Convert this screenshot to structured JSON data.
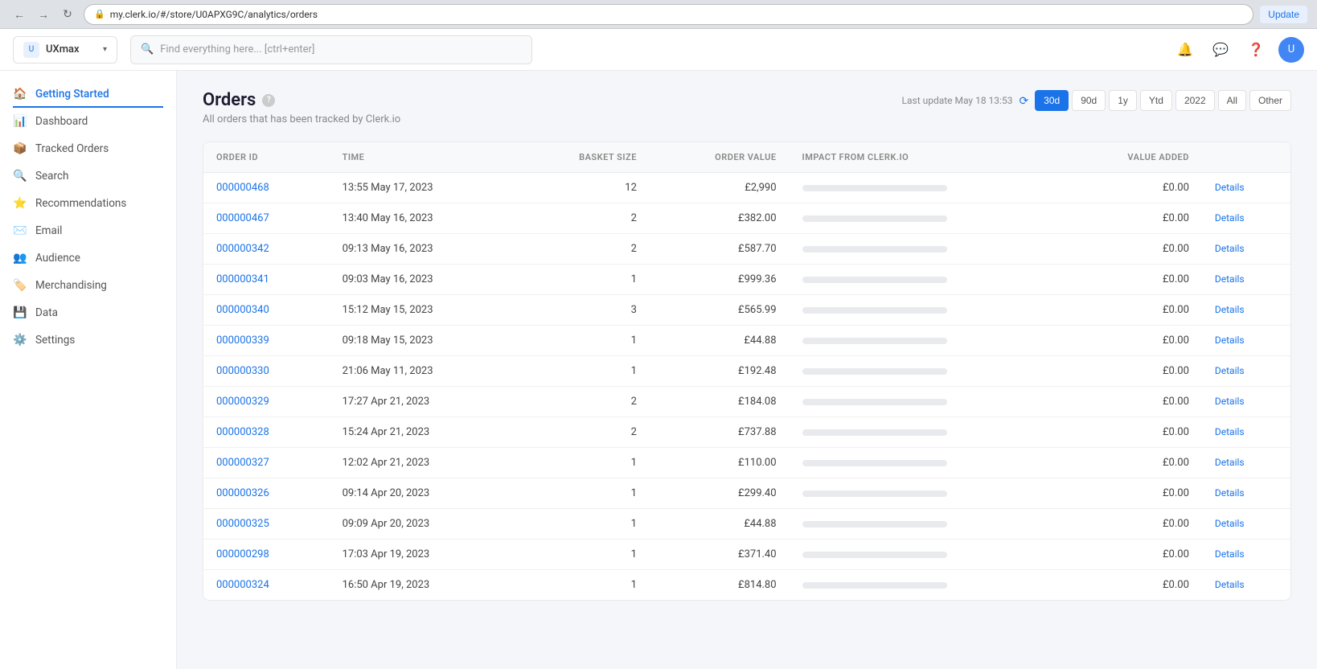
{
  "browser": {
    "url": "my.clerk.io/#/store/U0APXG9C/analytics/orders",
    "update_label": "Update"
  },
  "app": {
    "store_name": "UXmax",
    "search_placeholder": "Find everything here... [ctrl+enter]"
  },
  "sidebar": {
    "items": [
      {
        "id": "getting-started",
        "label": "Getting Started",
        "active": true,
        "icon": "🏠"
      },
      {
        "id": "dashboard",
        "label": "Dashboard",
        "active": false,
        "icon": "📊"
      },
      {
        "id": "tracked-orders",
        "label": "Tracked Orders",
        "active": false,
        "icon": "📦"
      },
      {
        "id": "search",
        "label": "Search",
        "active": false,
        "icon": "🔍"
      },
      {
        "id": "recommendations",
        "label": "Recommendations",
        "active": false,
        "icon": "⭐"
      },
      {
        "id": "email",
        "label": "Email",
        "active": false,
        "icon": "✉️"
      },
      {
        "id": "audience",
        "label": "Audience",
        "active": false,
        "icon": "👥"
      },
      {
        "id": "merchandising",
        "label": "Merchandising",
        "active": false,
        "icon": "🏷️"
      },
      {
        "id": "data",
        "label": "Data",
        "active": false,
        "icon": "💾"
      },
      {
        "id": "settings",
        "label": "Settings",
        "active": false,
        "icon": "⚙️"
      }
    ]
  },
  "page": {
    "title": "Orders",
    "subtitle": "All orders that has been tracked by Clerk.io",
    "last_update_label": "Last update May 18 13:53"
  },
  "time_filters": [
    {
      "label": "30d",
      "active": true
    },
    {
      "label": "90d",
      "active": false
    },
    {
      "label": "1y",
      "active": false
    },
    {
      "label": "Ytd",
      "active": false
    },
    {
      "label": "2022",
      "active": false
    },
    {
      "label": "All",
      "active": false
    },
    {
      "label": "Other",
      "active": false
    }
  ],
  "table": {
    "columns": [
      {
        "key": "order_id",
        "label": "ORDER ID"
      },
      {
        "key": "time",
        "label": "TIME"
      },
      {
        "key": "basket_size",
        "label": "BASKET SIZE"
      },
      {
        "key": "order_value",
        "label": "ORDER VALUE"
      },
      {
        "key": "impact",
        "label": "IMPACT FROM CLERK.IO"
      },
      {
        "key": "value_added",
        "label": "VALUE ADDED"
      },
      {
        "key": "action",
        "label": ""
      }
    ],
    "rows": [
      {
        "order_id": "000000468",
        "time": "13:55 May 17, 2023",
        "basket_size": "12",
        "order_value": "£2,990",
        "impact_pct": 0,
        "value_added": "£0.00"
      },
      {
        "order_id": "000000467",
        "time": "13:40 May 16, 2023",
        "basket_size": "2",
        "order_value": "£382.00",
        "impact_pct": 0,
        "value_added": "£0.00"
      },
      {
        "order_id": "000000342",
        "time": "09:13 May 16, 2023",
        "basket_size": "2",
        "order_value": "£587.70",
        "impact_pct": 0,
        "value_added": "£0.00"
      },
      {
        "order_id": "000000341",
        "time": "09:03 May 16, 2023",
        "basket_size": "1",
        "order_value": "£999.36",
        "impact_pct": 0,
        "value_added": "£0.00"
      },
      {
        "order_id": "000000340",
        "time": "15:12 May 15, 2023",
        "basket_size": "3",
        "order_value": "£565.99",
        "impact_pct": 0,
        "value_added": "£0.00"
      },
      {
        "order_id": "000000339",
        "time": "09:18 May 15, 2023",
        "basket_size": "1",
        "order_value": "£44.88",
        "impact_pct": 0,
        "value_added": "£0.00"
      },
      {
        "order_id": "000000330",
        "time": "21:06 May 11, 2023",
        "basket_size": "1",
        "order_value": "£192.48",
        "impact_pct": 0,
        "value_added": "£0.00"
      },
      {
        "order_id": "000000329",
        "time": "17:27 Apr 21, 2023",
        "basket_size": "2",
        "order_value": "£184.08",
        "impact_pct": 0,
        "value_added": "£0.00"
      },
      {
        "order_id": "000000328",
        "time": "15:24 Apr 21, 2023",
        "basket_size": "2",
        "order_value": "£737.88",
        "impact_pct": 0,
        "value_added": "£0.00"
      },
      {
        "order_id": "000000327",
        "time": "12:02 Apr 21, 2023",
        "basket_size": "1",
        "order_value": "£110.00",
        "impact_pct": 0,
        "value_added": "£0.00"
      },
      {
        "order_id": "000000326",
        "time": "09:14 Apr 20, 2023",
        "basket_size": "1",
        "order_value": "£299.40",
        "impact_pct": 0,
        "value_added": "£0.00"
      },
      {
        "order_id": "000000325",
        "time": "09:09 Apr 20, 2023",
        "basket_size": "1",
        "order_value": "£44.88",
        "impact_pct": 0,
        "value_added": "£0.00"
      },
      {
        "order_id": "000000298",
        "time": "17:03 Apr 19, 2023",
        "basket_size": "1",
        "order_value": "£371.40",
        "impact_pct": 0,
        "value_added": "£0.00"
      },
      {
        "order_id": "000000324",
        "time": "16:50 Apr 19, 2023",
        "basket_size": "1",
        "order_value": "£814.80",
        "impact_pct": 0,
        "value_added": "£0.00"
      }
    ],
    "details_label": "Details"
  }
}
